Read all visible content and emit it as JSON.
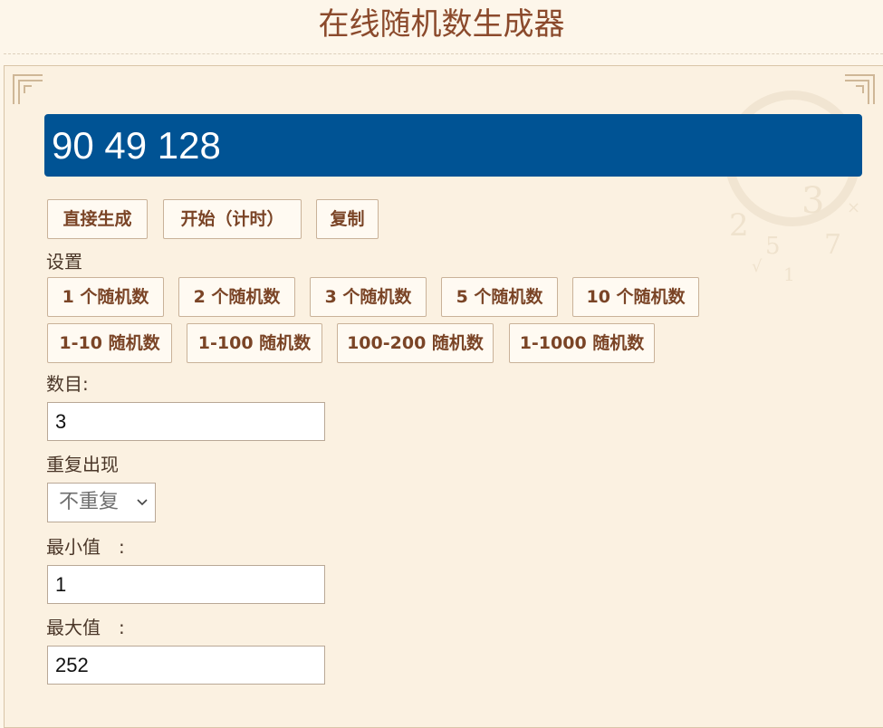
{
  "header": {
    "title": "在线随机数生成器"
  },
  "result": {
    "value": "90 49 128"
  },
  "actions": {
    "generate": "直接生成",
    "start_timed": "开始（计时）",
    "copy": "复制"
  },
  "settings": {
    "label": "设置",
    "count_presets": [
      "1 个随机数",
      "2 个随机数",
      "3 个随机数",
      "5 个随机数",
      "10 个随机数"
    ],
    "range_presets": [
      "1-10 随机数",
      "1-100 随机数",
      "100-200 随机数",
      "1-1000 随机数"
    ]
  },
  "form": {
    "count_label": "数目:",
    "count_value": "3",
    "repeat_label": "重复出现",
    "repeat_selected": "不重复",
    "min_label": "最小值　:",
    "min_value": "1",
    "max_label": "最大值　:",
    "max_value": "252"
  },
  "colors": {
    "background": "#fdf6ea",
    "result_bg": "#005394",
    "button_text": "#7a4426",
    "title": "#8b4a2c"
  }
}
